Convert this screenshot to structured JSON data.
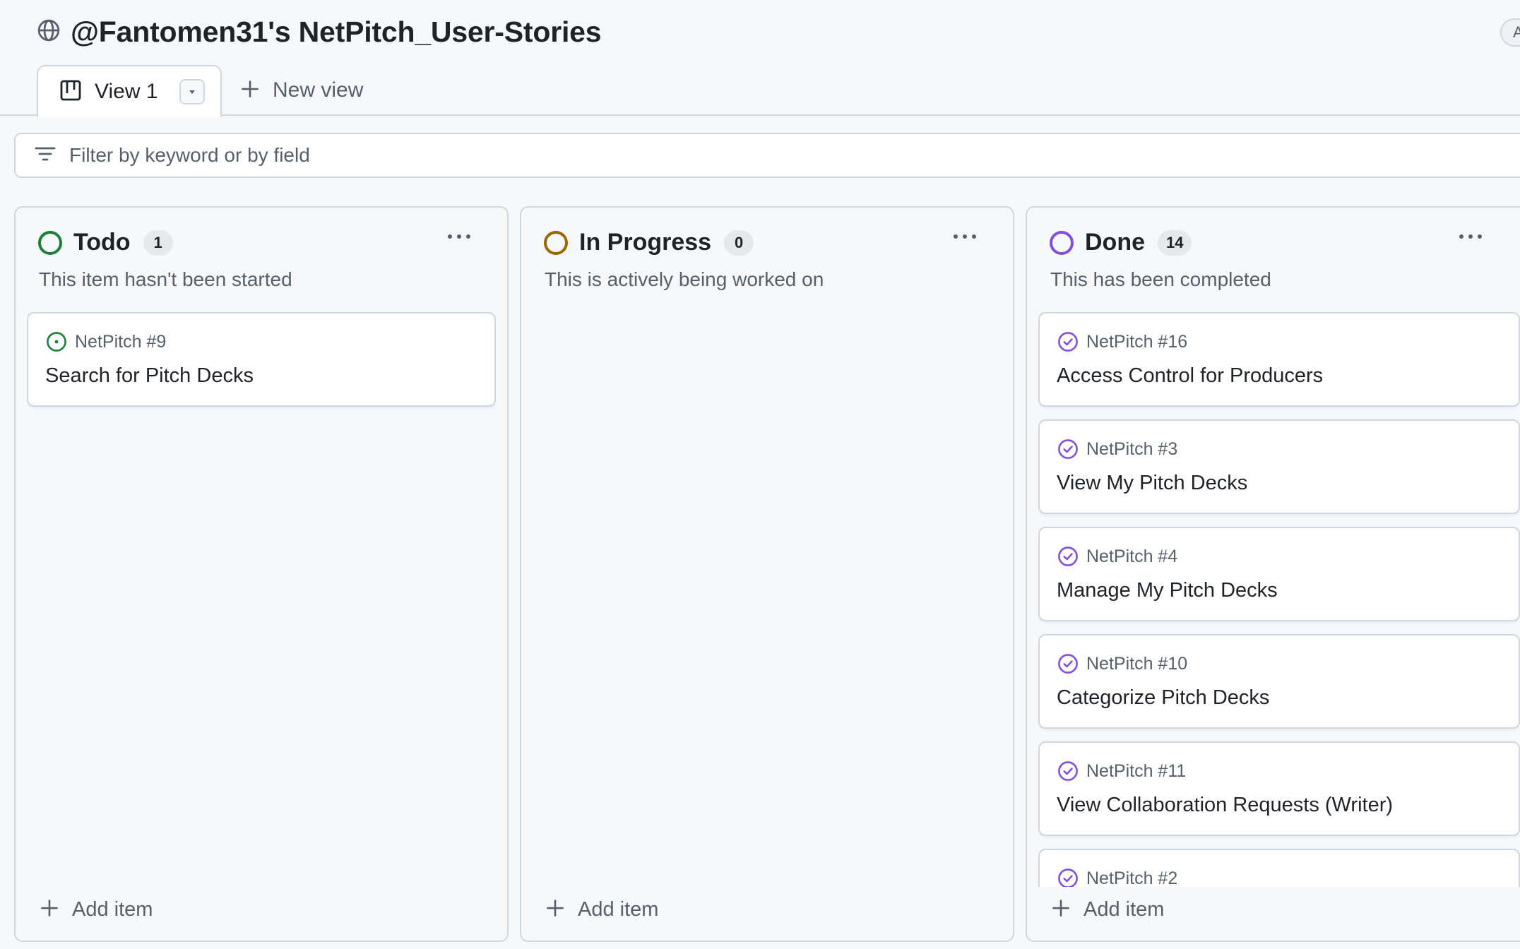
{
  "header": {
    "title": "@Fantomen31's NetPitch_User-Stories",
    "corner_pill_text": "A"
  },
  "tabs": {
    "active_label": "View 1",
    "new_view_label": "New view"
  },
  "filter": {
    "placeholder": "Filter by keyword or by field"
  },
  "columns": {
    "todo": {
      "title": "Todo",
      "count": "1",
      "description": "This item hasn't been started",
      "color": "#1a7f37",
      "add_label": "Add item",
      "cards": [
        {
          "ref": "NetPitch #9",
          "title": "Search for Pitch Decks",
          "state": "open"
        }
      ]
    },
    "in_progress": {
      "title": "In Progress",
      "count": "0",
      "description": "This is actively being worked on",
      "color": "#9a6700",
      "add_label": "Add item",
      "cards": []
    },
    "done": {
      "title": "Done",
      "count": "14",
      "description": "This has been completed",
      "color": "#8250df",
      "add_label": "Add item",
      "cards": [
        {
          "ref": "NetPitch #16",
          "title": "Access Control for Producers",
          "state": "closed"
        },
        {
          "ref": "NetPitch #3",
          "title": "View My Pitch Decks",
          "state": "closed"
        },
        {
          "ref": "NetPitch #4",
          "title": "Manage My Pitch Decks",
          "state": "closed"
        },
        {
          "ref": "NetPitch #10",
          "title": "Categorize Pitch Decks",
          "state": "closed"
        },
        {
          "ref": "NetPitch #11",
          "title": "View Collaboration Requests (Writer)",
          "state": "closed"
        },
        {
          "ref": "NetPitch #2",
          "title": "",
          "state": "closed"
        }
      ]
    }
  },
  "icons": {
    "title": "globe-icon",
    "tab": "board-view-icon",
    "tab_menu": "triangle-down-icon",
    "new_view": "plus-icon",
    "filter": "filter-icon",
    "column_menu": "kebab-horizontal-icon",
    "open_issue": "issue-opened-icon",
    "closed_issue": "issue-closed-icon",
    "add_item": "plus-icon"
  }
}
